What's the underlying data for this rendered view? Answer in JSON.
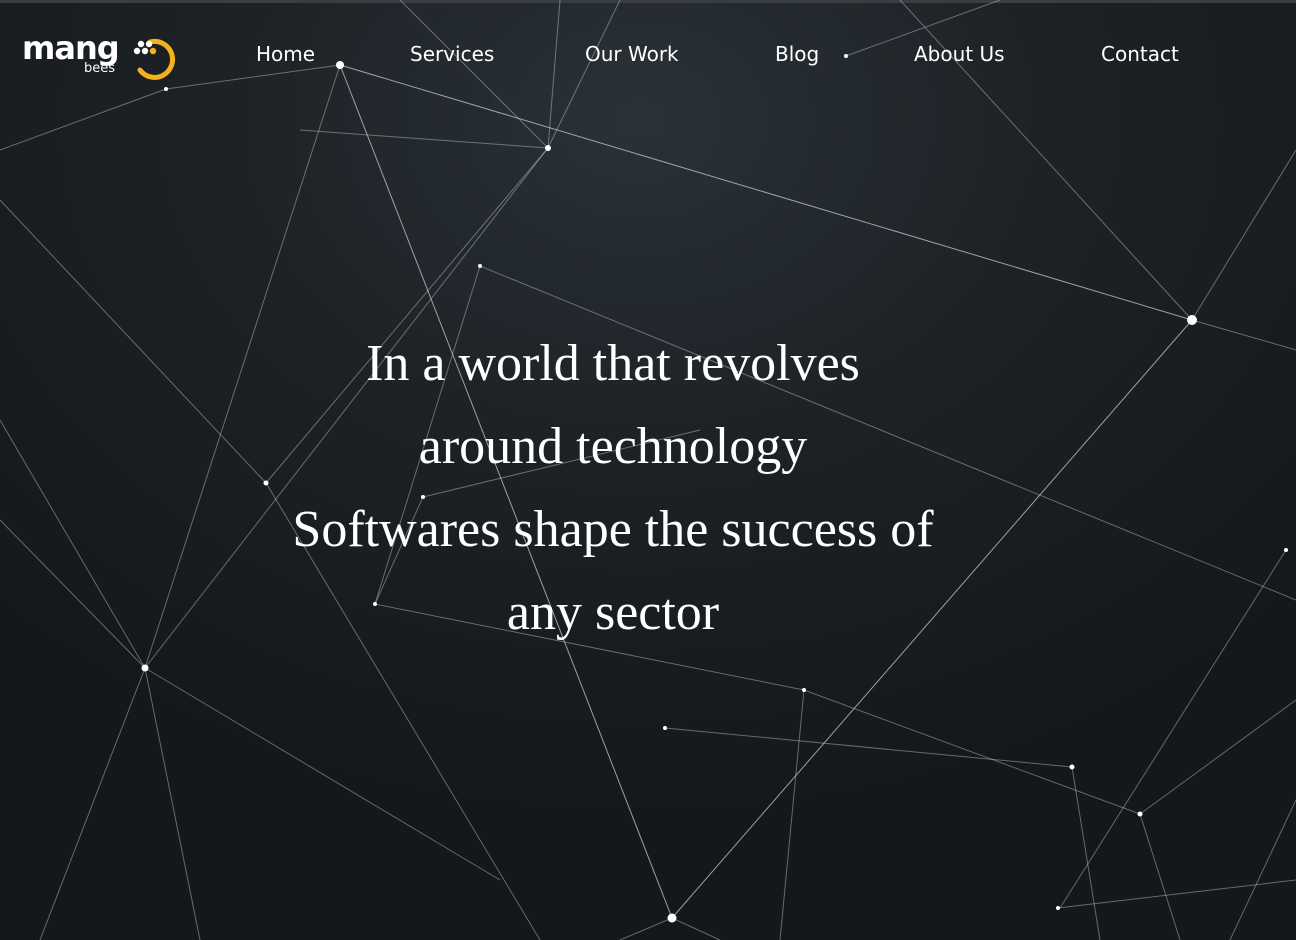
{
  "brand": {
    "name": "mang",
    "sub": "bees",
    "accent_color": "#f5b11a",
    "icon": "bee-honeycomb-logo-icon"
  },
  "nav": {
    "items": [
      {
        "label": "Home"
      },
      {
        "label": "Services"
      },
      {
        "label": "Our Work"
      },
      {
        "label": "Blog"
      },
      {
        "label": "About Us"
      },
      {
        "label": "Contact"
      }
    ]
  },
  "hero": {
    "lines": [
      "In a world that revolves",
      "around technology",
      "Softwares shape the success of",
      "any sector"
    ],
    "background": "network-graph-pattern"
  }
}
